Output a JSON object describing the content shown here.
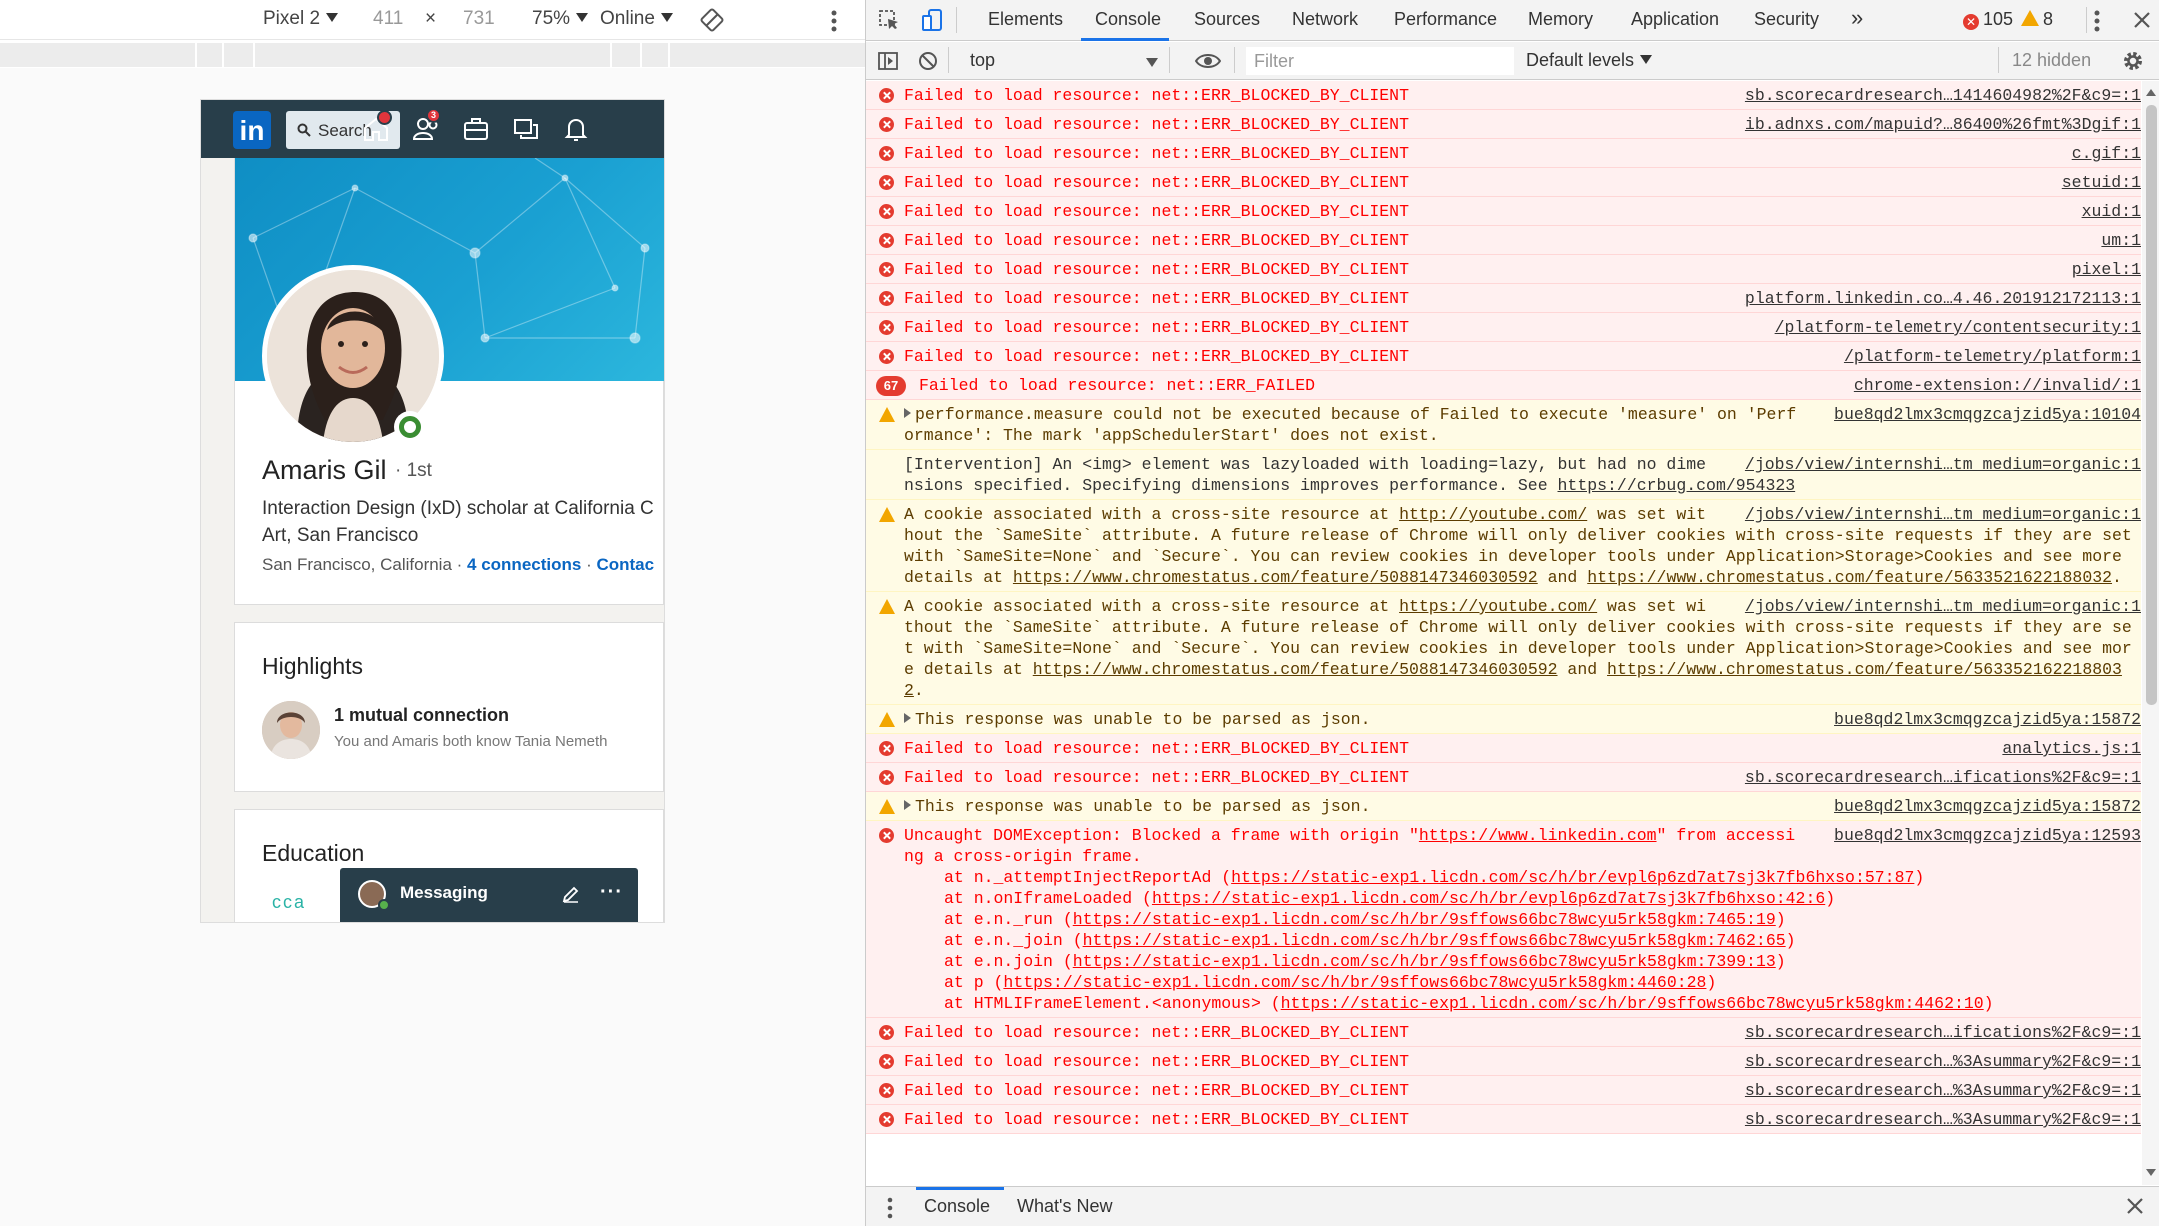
{
  "device_toolbar": {
    "device": "Pixel 2",
    "width": "411",
    "times": "×",
    "height": "731",
    "zoom": "75%",
    "throttle": "Online"
  },
  "linkedin": {
    "logo": "in",
    "search_placeholder": "Search",
    "connections_badge": "3",
    "name": "Amaris Gil",
    "degree": "· 1st",
    "headline_line1": "Interaction Design (IxD) scholar at California C",
    "headline_line2": "Art, San Francisco",
    "location": "San Francisco, California",
    "sep1": " · ",
    "connections": "4 connections",
    "sep2": " · ",
    "contact": "Contac",
    "highlights_title": "Highlights",
    "mutual_title": "1 mutual connection",
    "mutual_sub": "You and Amaris both know Tania Nemeth",
    "education_title": "Education",
    "cca_logo": "cca",
    "messaging_label": "Messaging",
    "messaging_more": "···",
    "colors": {
      "nav": "#283e4a",
      "brand": "#0a66c2",
      "online": "#3a8d32"
    }
  },
  "devtools": {
    "tabs": [
      "Elements",
      "Console",
      "Sources",
      "Network",
      "Performance",
      "Memory",
      "Application",
      "Security"
    ],
    "more_tabs": "»",
    "error_count": "105",
    "warning_count": "8",
    "context": "top",
    "filter_placeholder": "Filter",
    "levels": "Default levels",
    "hidden": "12 hidden",
    "drawer_tabs": [
      "Console",
      "What's New"
    ],
    "messages": [
      {
        "type": "error",
        "text": "Failed to load resource: net::ERR_BLOCKED_BY_CLIENT",
        "source": "sb.scorecardresearch…1414604982%2F&c9=:1"
      },
      {
        "type": "error",
        "text": "Failed to load resource: net::ERR_BLOCKED_BY_CLIENT",
        "source": "ib.adnxs.com/mapuid?…86400%26fmt%3Dgif:1"
      },
      {
        "type": "error",
        "text": "Failed to load resource: net::ERR_BLOCKED_BY_CLIENT",
        "source": "c.gif:1"
      },
      {
        "type": "error",
        "text": "Failed to load resource: net::ERR_BLOCKED_BY_CLIENT",
        "source": "setuid:1"
      },
      {
        "type": "error",
        "text": "Failed to load resource: net::ERR_BLOCKED_BY_CLIENT",
        "source": "xuid:1"
      },
      {
        "type": "error",
        "text": "Failed to load resource: net::ERR_BLOCKED_BY_CLIENT",
        "source": "um:1"
      },
      {
        "type": "error",
        "text": "Failed to load resource: net::ERR_BLOCKED_BY_CLIENT",
        "source": "pixel:1"
      },
      {
        "type": "error",
        "text": "Failed to load resource: net::ERR_BLOCKED_BY_CLIENT",
        "source": "platform.linkedin.co…4.46.201912172113:1"
      },
      {
        "type": "error",
        "text": "Failed to load resource: net::ERR_BLOCKED_BY_CLIENT",
        "source": "/platform-telemetry/contentsecurity:1"
      },
      {
        "type": "error",
        "text": "Failed to load resource: net::ERR_BLOCKED_BY_CLIENT",
        "source": "/platform-telemetry/platform:1"
      },
      {
        "type": "error",
        "count": "67",
        "text": "Failed to load resource: net::ERR_FAILED",
        "source": "chrome-extension://invalid/:1"
      },
      {
        "type": "warning",
        "expandable": true,
        "text": "performance.measure could not be executed because of Failed to execute 'measure' on 'Performance': The mark 'appSchedulerStart' does not exist.",
        "source": "bue8qd2lmx3cmqgzcajzid5ya:10104"
      },
      {
        "type": "info",
        "text": "[Intervention] An <img> element was lazyloaded with loading=lazy, but had no dimensions specified. Specifying dimensions improves performance. See ",
        "link": "https://crbug.com/954323",
        "source": "/jobs/view/internshi…tm_medium=organic:1"
      },
      {
        "type": "warning",
        "text_a": "A cookie associated with a cross-site resource at ",
        "link_a": "http://youtube.com/",
        "text_b": " was set without the `SameSite` attribute. A future release of Chrome will only deliver cookies with cross-site requests if they are set with `SameSite=None` and `Secure`. You can review cookies in developer tools under Application>Storage>Cookies and see more details at ",
        "link_b": "https://www.chromestatus.com/feature/5088147346030592",
        "text_c": " and ",
        "link_c": "https://www.chromestatus.com/feature/5633521622188032",
        "text_d": ".",
        "source": "/jobs/view/internshi…tm_medium=organic:1"
      },
      {
        "type": "warning",
        "text_a": "A cookie associated with a cross-site resource at ",
        "link_a": "https://youtube.com/",
        "text_b": " was set without the `SameSite` attribute. A future release of Chrome will only deliver cookies with cross-site requests if they are set with `SameSite=None` and `Secure`. You can review cookies in developer tools under Application>Storage>Cookies and see more details at ",
        "link_b": "https://www.chromestatus.com/feature/5088147346030592",
        "text_c": " and ",
        "link_c": "https://www.chromestatus.com/feature/5633521622188032",
        "text_d": ".",
        "source": "/jobs/view/internshi…tm_medium=organic:1"
      },
      {
        "type": "warning",
        "expandable": true,
        "text": "This response was unable to be parsed as json.",
        "source": "bue8qd2lmx3cmqgzcajzid5ya:15872"
      },
      {
        "type": "error",
        "text": "Failed to load resource: net::ERR_BLOCKED_BY_CLIENT",
        "source": "analytics.js:1"
      },
      {
        "type": "error",
        "text": "Failed to load resource: net::ERR_BLOCKED_BY_CLIENT",
        "source": "sb.scorecardresearch…ifications%2F&c9=:1"
      },
      {
        "type": "warning",
        "expandable": true,
        "text": "This response was unable to be parsed as json.",
        "source": "bue8qd2lmx3cmqgzcajzid5ya:15872"
      },
      {
        "type": "exception",
        "text_a": "Uncaught DOMException: Blocked a frame with origin \"",
        "link_a": "https://www.linkedin.com",
        "text_b": "\" from accessing a cross-origin frame.",
        "source": "bue8qd2lmx3cmqgzcajzid5ya:12593",
        "stack": [
          {
            "fn": "at n._attemptInjectReportAd (",
            "url": "https://static-exp1.licdn.com/sc/h/br/evpl6p6zd7at7sj3k7fb6hxso:57:87",
            "end": ")"
          },
          {
            "fn": "at n.onIframeLoaded (",
            "url": "https://static-exp1.licdn.com/sc/h/br/evpl6p6zd7at7sj3k7fb6hxso:42:6",
            "end": ")"
          },
          {
            "fn": "at e.n._run (",
            "url": "https://static-exp1.licdn.com/sc/h/br/9sffows66bc78wcyu5rk58gkm:7465:19",
            "end": ")"
          },
          {
            "fn": "at e.n._join (",
            "url": "https://static-exp1.licdn.com/sc/h/br/9sffows66bc78wcyu5rk58gkm:7462:65",
            "end": ")"
          },
          {
            "fn": "at e.n.join (",
            "url": "https://static-exp1.licdn.com/sc/h/br/9sffows66bc78wcyu5rk58gkm:7399:13",
            "end": ")"
          },
          {
            "fn": "at p (",
            "url": "https://static-exp1.licdn.com/sc/h/br/9sffows66bc78wcyu5rk58gkm:4460:28",
            "end": ")"
          },
          {
            "fn": "at HTMLIFrameElement.<anonymous> (",
            "url": "https://static-exp1.licdn.com/sc/h/br/9sffows66bc78wcyu5rk58gkm:4462:10",
            "end": ")"
          }
        ]
      },
      {
        "type": "error",
        "text": "Failed to load resource: net::ERR_BLOCKED_BY_CLIENT",
        "source": "sb.scorecardresearch…ifications%2F&c9=:1"
      },
      {
        "type": "error",
        "text": "Failed to load resource: net::ERR_BLOCKED_BY_CLIENT",
        "source": "sb.scorecardresearch…%3Asummary%2F&c9=:1"
      },
      {
        "type": "error",
        "text": "Failed to load resource: net::ERR_BLOCKED_BY_CLIENT",
        "source": "sb.scorecardresearch…%3Asummary%2F&c9=:1"
      },
      {
        "type": "error",
        "text": "Failed to load resource: net::ERR_BLOCKED_BY_CLIENT",
        "source": "sb.scorecardresearch…%3Asummary%2F&c9=:1"
      }
    ]
  }
}
